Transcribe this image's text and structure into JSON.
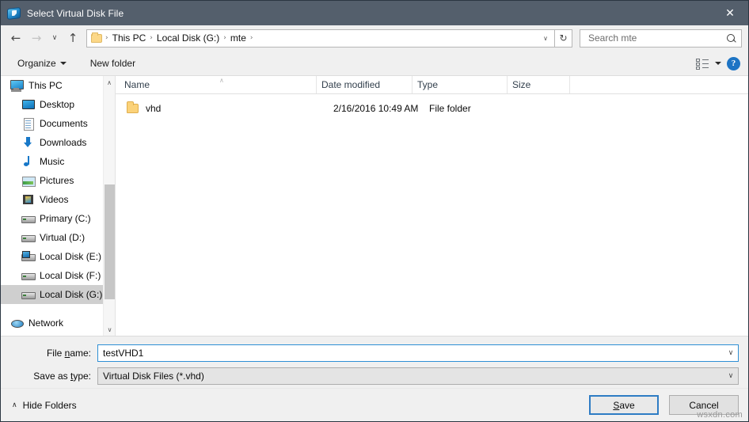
{
  "window": {
    "title": "Select Virtual Disk File",
    "icon": "virtual-disk-icon",
    "close_label": "✕"
  },
  "navigation": {
    "back_label": "←",
    "forward_label": "→",
    "recent_label": "∨",
    "up_label": "↑",
    "refresh_label": "↻",
    "dropdown_label": "∨",
    "breadcrumbs": [
      {
        "label": "This PC",
        "separator": "›"
      },
      {
        "label": "Local Disk (G:)",
        "separator": "›"
      },
      {
        "label": "mte",
        "separator": "›"
      }
    ]
  },
  "search": {
    "placeholder": "Search mte",
    "value": "",
    "icon": "search-icon"
  },
  "toolbar": {
    "organize_label": "Organize",
    "new_folder_label": "New folder",
    "view_icon": "view-layout-icon",
    "view_dropdown": "▾",
    "help_label": "?"
  },
  "sidebar": {
    "items": [
      {
        "label": "This PC",
        "icon": "computer-icon",
        "indent": false,
        "selected": false
      },
      {
        "label": "Desktop",
        "icon": "desktop-icon",
        "indent": true,
        "selected": false
      },
      {
        "label": "Documents",
        "icon": "documents-icon",
        "indent": true,
        "selected": false
      },
      {
        "label": "Downloads",
        "icon": "downloads-icon",
        "indent": true,
        "selected": false
      },
      {
        "label": "Music",
        "icon": "music-icon",
        "indent": true,
        "selected": false
      },
      {
        "label": "Pictures",
        "icon": "pictures-icon",
        "indent": true,
        "selected": false
      },
      {
        "label": "Videos",
        "icon": "videos-icon",
        "indent": true,
        "selected": false
      },
      {
        "label": "Primary (C:)",
        "icon": "drive-icon",
        "indent": true,
        "selected": false
      },
      {
        "label": "Virtual (D:)",
        "icon": "drive-icon",
        "indent": true,
        "selected": false
      },
      {
        "label": "Local Disk (E:)",
        "icon": "system-drive-icon",
        "indent": true,
        "selected": false
      },
      {
        "label": "Local Disk (F:)",
        "icon": "drive-icon",
        "indent": true,
        "selected": false
      },
      {
        "label": "Local Disk (G:)",
        "icon": "drive-icon",
        "indent": true,
        "selected": true
      },
      {
        "label": "Network",
        "icon": "network-icon",
        "indent": false,
        "selected": false
      }
    ],
    "scroll_up": "∧",
    "scroll_down": "∨"
  },
  "filelist": {
    "columns": [
      {
        "label": "Name"
      },
      {
        "label": "Date modified"
      },
      {
        "label": "Type"
      },
      {
        "label": "Size"
      }
    ],
    "sort_indicator": "∧",
    "rows": [
      {
        "name": "vhd",
        "date_modified": "2/16/2016 10:49 AM",
        "type": "File folder",
        "size": "",
        "icon": "folder-icon"
      }
    ]
  },
  "form": {
    "filename_label_pre": "File ",
    "filename_label_key": "n",
    "filename_label_post": "ame:",
    "filename_value": "testVHD1",
    "filetype_label_pre": "Save as ",
    "filetype_label_key": "t",
    "filetype_label_post": "ype:",
    "filetype_value": "Virtual Disk Files (*.vhd)",
    "dropdown_glyph": "∨"
  },
  "footer": {
    "hide_folders_label": "Hide Folders",
    "hide_folders_caret": "∧",
    "save_label_pre": "",
    "save_label_key": "S",
    "save_label_post": "ave",
    "cancel_label": "Cancel",
    "watermark": "wsxdn.com"
  },
  "colors": {
    "titlebar": "#545f6c",
    "accent": "#2e7cc4",
    "selection": "#cfcfcf",
    "folder": "#fbd279"
  }
}
